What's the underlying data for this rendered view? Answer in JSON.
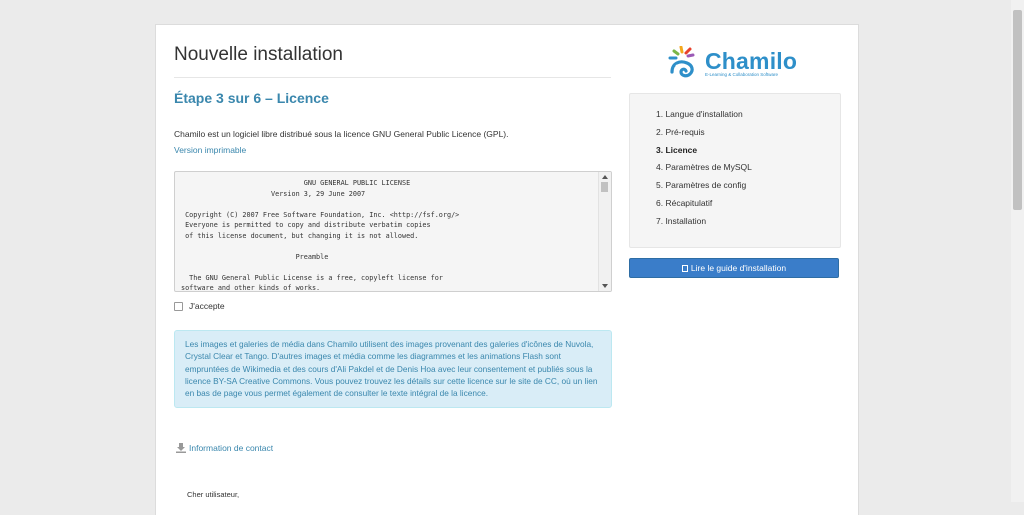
{
  "page": {
    "title": "Nouvelle installation",
    "step_heading": "Étape 3 sur 6 – Licence",
    "intro": "Chamilo est un logiciel libre distribué sous la licence GNU General Public Licence (GPL).",
    "print_link": "Version imprimable",
    "license_text": "                              GNU GENERAL PUBLIC LICENSE\n                      Version 3, 29 June 2007\n\n Copyright (C) 2007 Free Software Foundation, Inc. <http://fsf.org/>\n Everyone is permitted to copy and distribute verbatim copies\n of this license document, but changing it is not allowed.\n\n                            Preamble\n\n  The GNU General Public License is a free, copyleft license for\nsoftware and other kinds of works.",
    "accept_label": "J'accepte",
    "info_text": "Les images et galeries de média dans Chamilo utilisent des images provenant des galeries d'icônes de Nuvola, Crystal Clear et Tango. D'autres images et média comme les diagrammes et les animations Flash sont empruntées de Wikimedia et des cours d'Ali Pakdel et de Denis Hoa avec leur consentement et publiés sous la licence BY-SA Creative Commons. Vous pouvez trouvez les détails sur cette licence sur le site de CC, où un lien en bas de page vous permet également de consulter le texte intégral de la licence.",
    "contact_link": "Information de contact",
    "greeting": "Cher utilisateur,"
  },
  "logo": {
    "name": "Chamilo",
    "tagline": "E-Learning & Collaboration Software"
  },
  "steps": [
    {
      "label": "1. Langue d'installation",
      "active": false
    },
    {
      "label": "2. Pré-requis",
      "active": false
    },
    {
      "label": "3. Licence",
      "active": true
    },
    {
      "label": "4. Paramètres de MySQL",
      "active": false
    },
    {
      "label": "5. Paramètres de config",
      "active": false
    },
    {
      "label": "6. Récapitulatif",
      "active": false
    },
    {
      "label": "7. Installation",
      "active": false
    }
  ],
  "guide_button": "Lire le guide d'installation",
  "colors": {
    "accent": "#3a87ad",
    "button": "#3a7dc9",
    "info_bg": "#d9edf7",
    "logo": "#2e8fc9"
  }
}
